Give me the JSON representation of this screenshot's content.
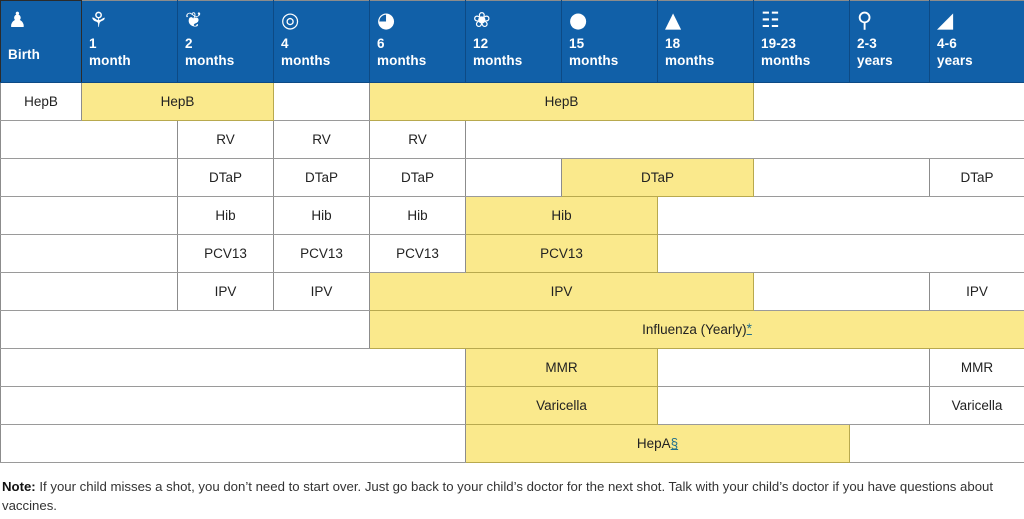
{
  "colors": {
    "header_blue": "#1160A8",
    "highlight_yellow": "#FAE98C",
    "grid_line": "#8C8C8C",
    "link_teal": "#1F6E8C",
    "cell_white": "#FFFFFF"
  },
  "table": {
    "columns": [
      {
        "label": "Birth",
        "icon": "stroller-icon",
        "glyph": "♟"
      },
      {
        "label": "1\nmonth",
        "icon": "rattle-icon",
        "glyph": "⚘"
      },
      {
        "label": "2\nmonths",
        "icon": "rubber-duck-icon",
        "glyph": "❦"
      },
      {
        "label": "4\nmonths",
        "icon": "teething-rings-icon",
        "glyph": "◎"
      },
      {
        "label": "6\nmonths",
        "icon": "bib-icon",
        "glyph": "◕"
      },
      {
        "label": "12\nmonths",
        "icon": "baby-bottle-icon",
        "glyph": "❀"
      },
      {
        "label": "15\nmonths",
        "icon": "beach-ball-icon",
        "glyph": "●"
      },
      {
        "label": "18\nmonths",
        "icon": "stacking-rings-toy-icon",
        "glyph": "▲"
      },
      {
        "label": "19-23\nmonths",
        "icon": "toy-train-icon",
        "glyph": "☷"
      },
      {
        "label": "2-3\nyears",
        "icon": "bicycle-icon",
        "glyph": "⚲"
      },
      {
        "label": "4-6\nyears",
        "icon": "backpack-icon",
        "glyph": "◢"
      }
    ],
    "rows": [
      {
        "vaccine": "HepB",
        "cells": [
          {
            "text": "HepB",
            "span": 1,
            "highlight": false
          },
          {
            "text": "HepB",
            "span": 2,
            "highlight": true
          },
          {
            "text": "",
            "span": 1,
            "highlight": false
          },
          {
            "text": "HepB",
            "span": 4,
            "highlight": true
          },
          {
            "text": "",
            "span": 3,
            "highlight": false
          }
        ]
      },
      {
        "vaccine": "RV",
        "cells": [
          {
            "text": "",
            "span": 2,
            "highlight": false
          },
          {
            "text": "RV",
            "span": 1,
            "highlight": false
          },
          {
            "text": "RV",
            "span": 1,
            "highlight": false
          },
          {
            "text": "RV",
            "span": 1,
            "highlight": false
          },
          {
            "text": "",
            "span": 6,
            "highlight": false
          }
        ]
      },
      {
        "vaccine": "DTaP",
        "cells": [
          {
            "text": "",
            "span": 2,
            "highlight": false
          },
          {
            "text": "DTaP",
            "span": 1,
            "highlight": false
          },
          {
            "text": "DTaP",
            "span": 1,
            "highlight": false
          },
          {
            "text": "DTaP",
            "span": 1,
            "highlight": false
          },
          {
            "text": "",
            "span": 1,
            "highlight": false
          },
          {
            "text": "DTaP",
            "span": 2,
            "highlight": true
          },
          {
            "text": "",
            "span": 2,
            "highlight": false
          },
          {
            "text": "DTaP",
            "span": 1,
            "highlight": false
          }
        ]
      },
      {
        "vaccine": "Hib",
        "cells": [
          {
            "text": "",
            "span": 2,
            "highlight": false
          },
          {
            "text": "Hib",
            "span": 1,
            "highlight": false
          },
          {
            "text": "Hib",
            "span": 1,
            "highlight": false
          },
          {
            "text": "Hib",
            "span": 1,
            "highlight": false
          },
          {
            "text": "Hib",
            "span": 2,
            "highlight": true
          },
          {
            "text": "",
            "span": 4,
            "highlight": false
          }
        ]
      },
      {
        "vaccine": "PCV13",
        "cells": [
          {
            "text": "",
            "span": 2,
            "highlight": false
          },
          {
            "text": "PCV13",
            "span": 1,
            "highlight": false
          },
          {
            "text": "PCV13",
            "span": 1,
            "highlight": false
          },
          {
            "text": "PCV13",
            "span": 1,
            "highlight": false
          },
          {
            "text": "PCV13",
            "span": 2,
            "highlight": true
          },
          {
            "text": "",
            "span": 4,
            "highlight": false
          }
        ]
      },
      {
        "vaccine": "IPV",
        "cells": [
          {
            "text": "",
            "span": 2,
            "highlight": false
          },
          {
            "text": "IPV",
            "span": 1,
            "highlight": false
          },
          {
            "text": "IPV",
            "span": 1,
            "highlight": false
          },
          {
            "text": "IPV",
            "span": 4,
            "highlight": true
          },
          {
            "text": "",
            "span": 2,
            "highlight": false
          },
          {
            "text": "IPV",
            "span": 1,
            "highlight": false
          }
        ]
      },
      {
        "vaccine": "Influenza",
        "cells": [
          {
            "text": "",
            "span": 4,
            "highlight": false
          },
          {
            "text": "Influenza (Yearly)",
            "footnote": "*",
            "span": 7,
            "highlight": true
          }
        ]
      },
      {
        "vaccine": "MMR",
        "cells": [
          {
            "text": "",
            "span": 5,
            "highlight": false
          },
          {
            "text": "MMR",
            "span": 2,
            "highlight": true
          },
          {
            "text": "",
            "span": 3,
            "highlight": false
          },
          {
            "text": "MMR",
            "span": 1,
            "highlight": false
          }
        ]
      },
      {
        "vaccine": "Varicella",
        "cells": [
          {
            "text": "",
            "span": 5,
            "highlight": false
          },
          {
            "text": "Varicella",
            "span": 2,
            "highlight": true
          },
          {
            "text": "",
            "span": 3,
            "highlight": false
          },
          {
            "text": "Varicella",
            "span": 1,
            "highlight": false
          }
        ]
      },
      {
        "vaccine": "HepA",
        "cells": [
          {
            "text": "",
            "span": 5,
            "highlight": false
          },
          {
            "text": "HepA",
            "footnote": "§",
            "span": 4,
            "highlight": true
          },
          {
            "text": "",
            "span": 2,
            "highlight": false
          }
        ]
      }
    ]
  },
  "note": {
    "label": "Note:",
    "text": " If your child misses a shot, you don’t need to start over. Just go back to your child’s doctor for the next shot. Talk with your child’s doctor if you have questions about vaccines."
  }
}
